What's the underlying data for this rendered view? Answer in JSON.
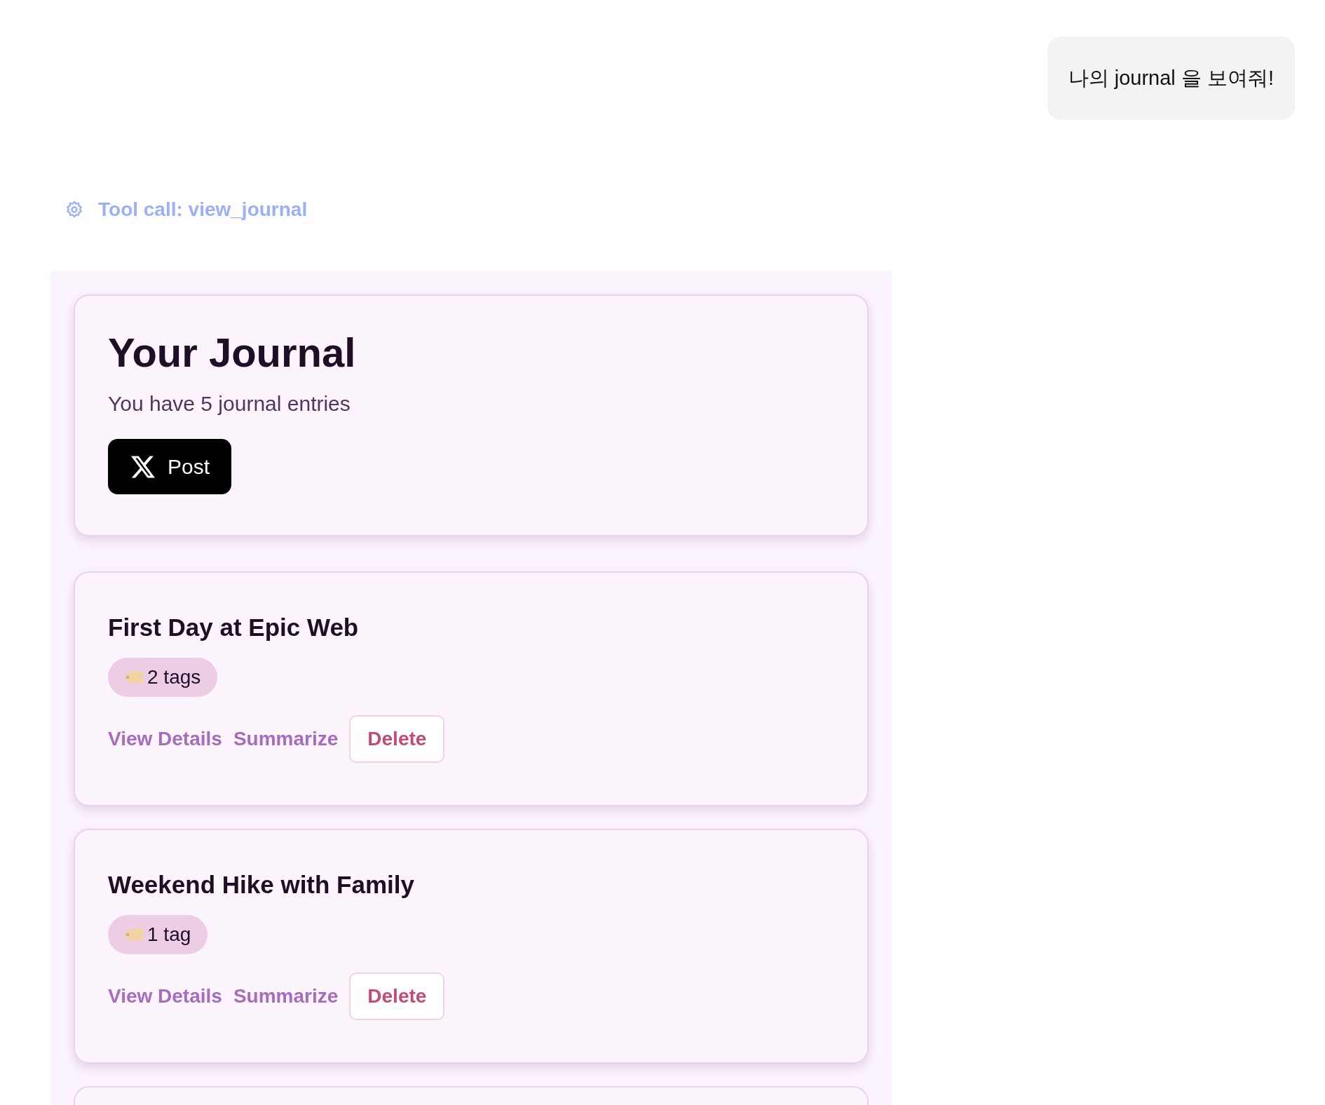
{
  "user_message": {
    "text": "나의 journal 을 보여줘!"
  },
  "tool_call": {
    "label": "Tool call: view_journal"
  },
  "journal": {
    "title": "Your Journal",
    "subtitle": "You have 5 journal entries",
    "post_button": "Post",
    "entries": [
      {
        "title": "First Day at Epic Web",
        "tags": "2 tags",
        "actions": [
          "View Details",
          "Summarize"
        ],
        "delete": "Delete"
      },
      {
        "title": "Weekend Hike with Family",
        "tags": "1 tag",
        "actions": [
          "View Details",
          "Summarize"
        ],
        "delete": "Delete"
      }
    ]
  }
}
